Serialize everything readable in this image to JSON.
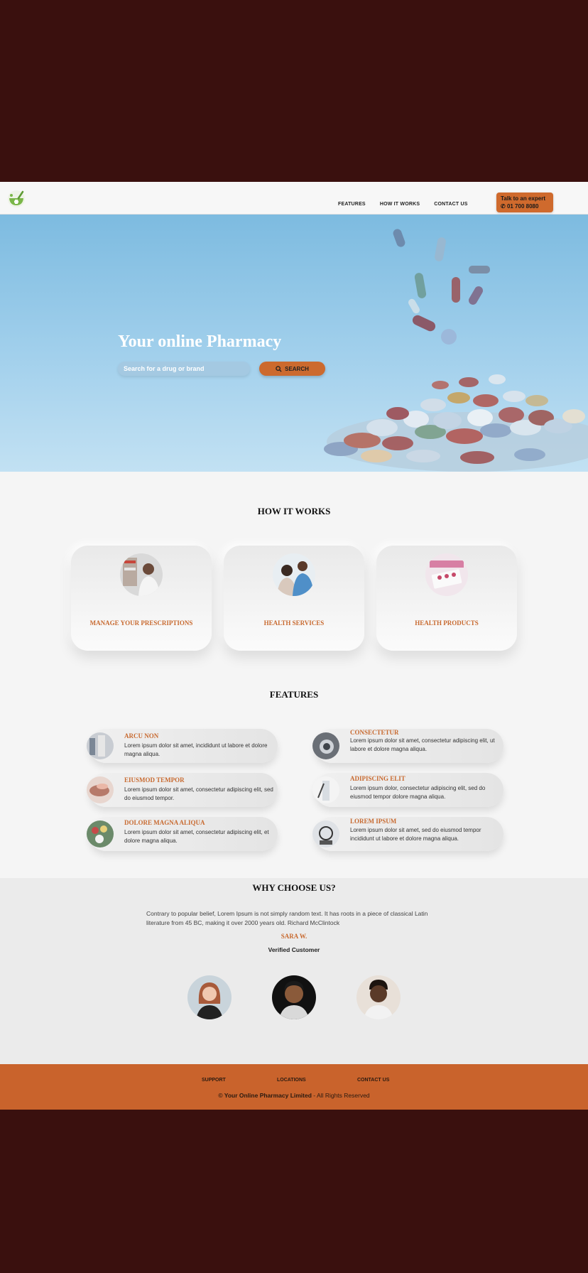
{
  "nav": {
    "links": [
      "FEATURES",
      "HOW IT WORKS",
      "CONTACT US"
    ],
    "expert_label": "Talk to an expert",
    "expert_phone": "01 700 8080",
    "logo_icon": "mortar-pestle-icon"
  },
  "hero": {
    "title": "Your online Pharmacy",
    "search_placeholder": "Search for a drug or brand",
    "search_button": "SEARCH"
  },
  "how_it_works": {
    "title": "HOW IT WORKS",
    "cards": [
      {
        "label": "MANAGE YOUR PRESCRIPTIONS"
      },
      {
        "label": "HEALTH SERVICES"
      },
      {
        "label": "HEALTH PRODUCTS"
      }
    ]
  },
  "features": {
    "title": "FEATURES",
    "items": [
      {
        "title": "ARCU NON",
        "text": "Lorem ipsum dolor sit amet, incididunt ut labore et dolore magna aliqua."
      },
      {
        "title": "CONSECTETUR",
        "text": "Lorem ipsum dolor sit amet, consectetur adipiscing elit, ut labore et dolore magna aliqua."
      },
      {
        "title": "EIUSMOD TEMPOR",
        "text": "Lorem ipsum dolor sit amet, consectetur adipiscing elit, sed do eiusmod tempor."
      },
      {
        "title": "ADIPISCING ELIT",
        "text": "Lorem ipsum dolor, consectetur adipiscing elit, sed do eiusmod tempor dolore magna aliqua."
      },
      {
        "title": "DOLORE MAGNA ALIQUA",
        "text": "Lorem ipsum dolor sit amet, consectetur adipiscing elit, et dolore magna aliqua."
      },
      {
        "title": "LOREM IPSUM",
        "text": "Lorem ipsum dolor sit amet, sed do eiusmod tempor incididunt ut labore et dolore magna aliqua."
      }
    ]
  },
  "why": {
    "title": "WHY CHOOSE US?",
    "text": "Contrary to popular belief, Lorem Ipsum is not simply random text. It has roots in a piece of classical Latin literature from 45 BC, making it over 2000 years old. Richard McClintock",
    "name": "SARA W.",
    "role": "Verified Customer"
  },
  "footer": {
    "links": [
      "SUPPORT",
      "LOCATIONS",
      "CONTACT US"
    ],
    "copyright_brand": "© Your Online Pharmacy Limited",
    "copyright_rest": " - All Rights Reserved"
  },
  "colors": {
    "accent": "#cc6a2e",
    "background_outer": "#3a100e",
    "hero_sky": "#7dbbe0"
  }
}
